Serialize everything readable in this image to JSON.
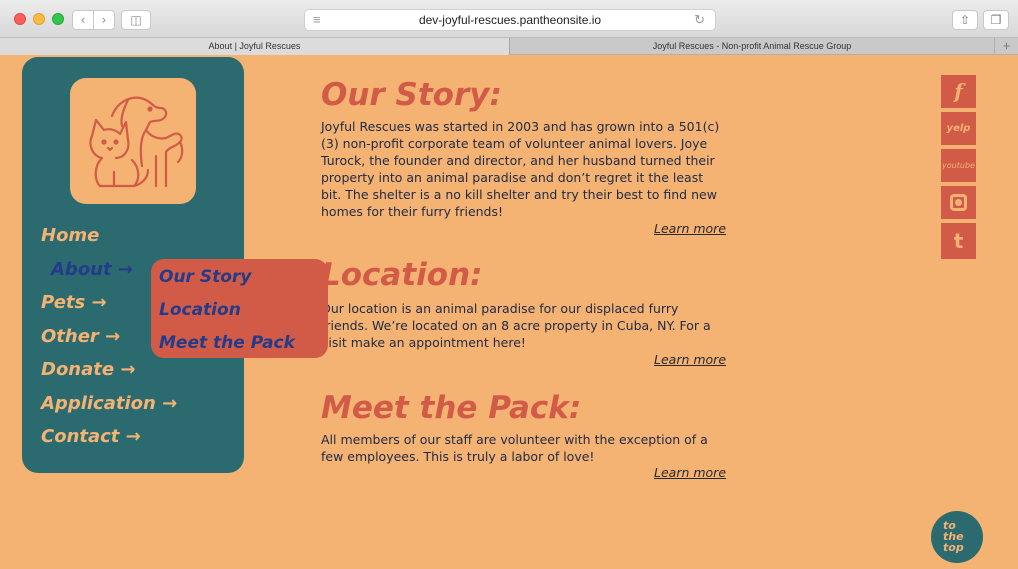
{
  "browser": {
    "url": "dev-joyful-rescues.pantheonsite.io",
    "tabs": [
      {
        "label": "About | Joyful Rescues"
      },
      {
        "label": "Joyful Rescues - Non-profit Animal Rescue Group"
      }
    ],
    "icons": [
      "back-icon",
      "forward-icon",
      "sidebar-icon",
      "menu-icon",
      "reload-icon",
      "share-icon",
      "tabs-icon",
      "plus-icon"
    ]
  },
  "nav": {
    "items": [
      {
        "label": "Home"
      },
      {
        "label": "About →"
      },
      {
        "label": "Pets →"
      },
      {
        "label": "Other →"
      },
      {
        "label": "Donate →"
      },
      {
        "label": "Application →"
      },
      {
        "label": "Contact →"
      }
    ],
    "submenu": [
      {
        "label": "Our Story"
      },
      {
        "label": "Location"
      },
      {
        "label": "Meet the Pack"
      }
    ]
  },
  "sections": {
    "story": {
      "title": "Our Story:",
      "body": "Joyful Rescues was started in 2003 and has grown into a 501(c)(3) non-profit corporate team of volunteer animal lovers. Joye Turock, the founder and director, and her husband turned their property into an animal paradise and don’t regret it the least bit. The shelter is a no kill shelter and try their best to find new homes for their furry friends!",
      "link": "Learn more"
    },
    "location": {
      "title": "Location:",
      "body": "Our location is an animal paradise for our displaced furry friends. We’re located on an 8 acre property in Cuba, NY. For a visit make an appointment here!",
      "link": "Learn more"
    },
    "pack": {
      "title": "Meet the Pack:",
      "body": "All members of our staff are volunteer with the exception of a few employees. This is truly a labor of love!",
      "link": "Learn more"
    }
  },
  "social": {
    "facebook": "f",
    "yelp": "yelp",
    "youtube": "youtube",
    "tumblr": "t"
  },
  "to_top": [
    "to",
    "the",
    "top"
  ],
  "colors": {
    "background": "#f4b273",
    "sidebar": "#2b6b70",
    "accent": "#d25b48",
    "nav_active": "#243b8a"
  }
}
